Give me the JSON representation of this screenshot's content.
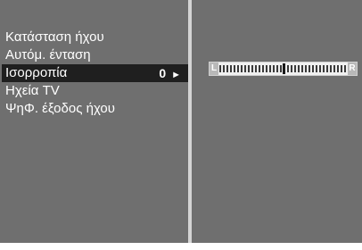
{
  "menu": {
    "items": [
      {
        "label": "Κατάσταση ήχου"
      },
      {
        "label": "Αυτόμ. ένταση"
      },
      {
        "label": "Ισορροπία",
        "value": "0",
        "arrow": "►"
      },
      {
        "label": "Ηχεία TV"
      },
      {
        "label": "ΨηΦ. έξοδος ήχου"
      }
    ],
    "selected_index": 2
  },
  "balance": {
    "left_label": "L",
    "right_label": "R",
    "value": 0
  }
}
